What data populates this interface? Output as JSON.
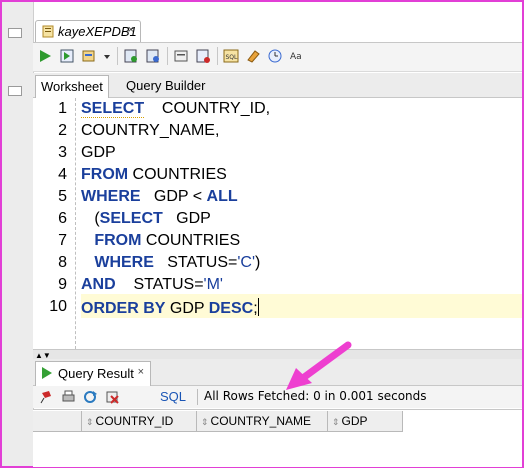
{
  "document_tab": {
    "title": "kayeXEPDB1",
    "close": "×"
  },
  "toolbar": {
    "icons": [
      "run-statement-icon",
      "run-script-icon",
      "autotrace-icon",
      "dropdown-icon",
      "commit-icon",
      "rollback-icon",
      "unshared-sql-icon",
      "explain-plan-icon",
      "sql-tuning-icon",
      "clear-icon",
      "history-icon",
      "format-icon"
    ]
  },
  "sub_tabs": [
    "Worksheet",
    "Query Builder"
  ],
  "editor": {
    "line_numbers": [
      "1",
      "2",
      "3",
      "4",
      "5",
      "6",
      "7",
      "8",
      "9",
      "10"
    ],
    "lines": [
      [
        {
          "t": "SELECT",
          "k": true
        },
        {
          "t": "    COUNTRY_ID,",
          "k": false
        }
      ],
      [
        {
          "t": "COUNTRY_NAME,",
          "k": false
        }
      ],
      [
        {
          "t": "GDP",
          "k": false
        }
      ],
      [
        {
          "t": "FROM",
          "k": true
        },
        {
          "t": " COUNTRIES",
          "k": false
        }
      ],
      [
        {
          "t": "WHERE",
          "k": true
        },
        {
          "t": "   GDP < ",
          "k": false
        },
        {
          "t": "ALL",
          "k": true
        }
      ],
      [
        {
          "t": "   (",
          "k": false
        },
        {
          "t": "SELECT",
          "k": true
        },
        {
          "t": "   GDP",
          "k": false
        }
      ],
      [
        {
          "t": "   ",
          "k": false
        },
        {
          "t": "FROM",
          "k": true
        },
        {
          "t": " COUNTRIES",
          "k": false
        }
      ],
      [
        {
          "t": "   ",
          "k": false
        },
        {
          "t": "WHERE",
          "k": true
        },
        {
          "t": "   STATUS=",
          "k": false
        },
        {
          "t": "'C'",
          "s": true
        },
        {
          "t": ")",
          "k": false
        }
      ],
      [
        {
          "t": "AND",
          "k": true
        },
        {
          "t": "    STATUS=",
          "k": false
        },
        {
          "t": "'M'",
          "s": true
        }
      ],
      [
        {
          "t": "ORDER BY",
          "k": true
        },
        {
          "t": " GDP ",
          "k": false
        },
        {
          "t": "DESC",
          "k": true
        },
        {
          "t": ";",
          "k": false
        }
      ]
    ]
  },
  "result_panel": {
    "tab_label": "Query Result",
    "tab_close": "×",
    "sql_link": "SQL",
    "status": "All Rows Fetched: 0 in 0.001 seconds",
    "columns": [
      "COUNTRY_ID",
      "COUNTRY_NAME",
      "GDP"
    ]
  },
  "colors": {
    "keyword": "#1a3f9c",
    "annotation_arrow": "#ee3fd0",
    "frame": "#e23fd6"
  }
}
